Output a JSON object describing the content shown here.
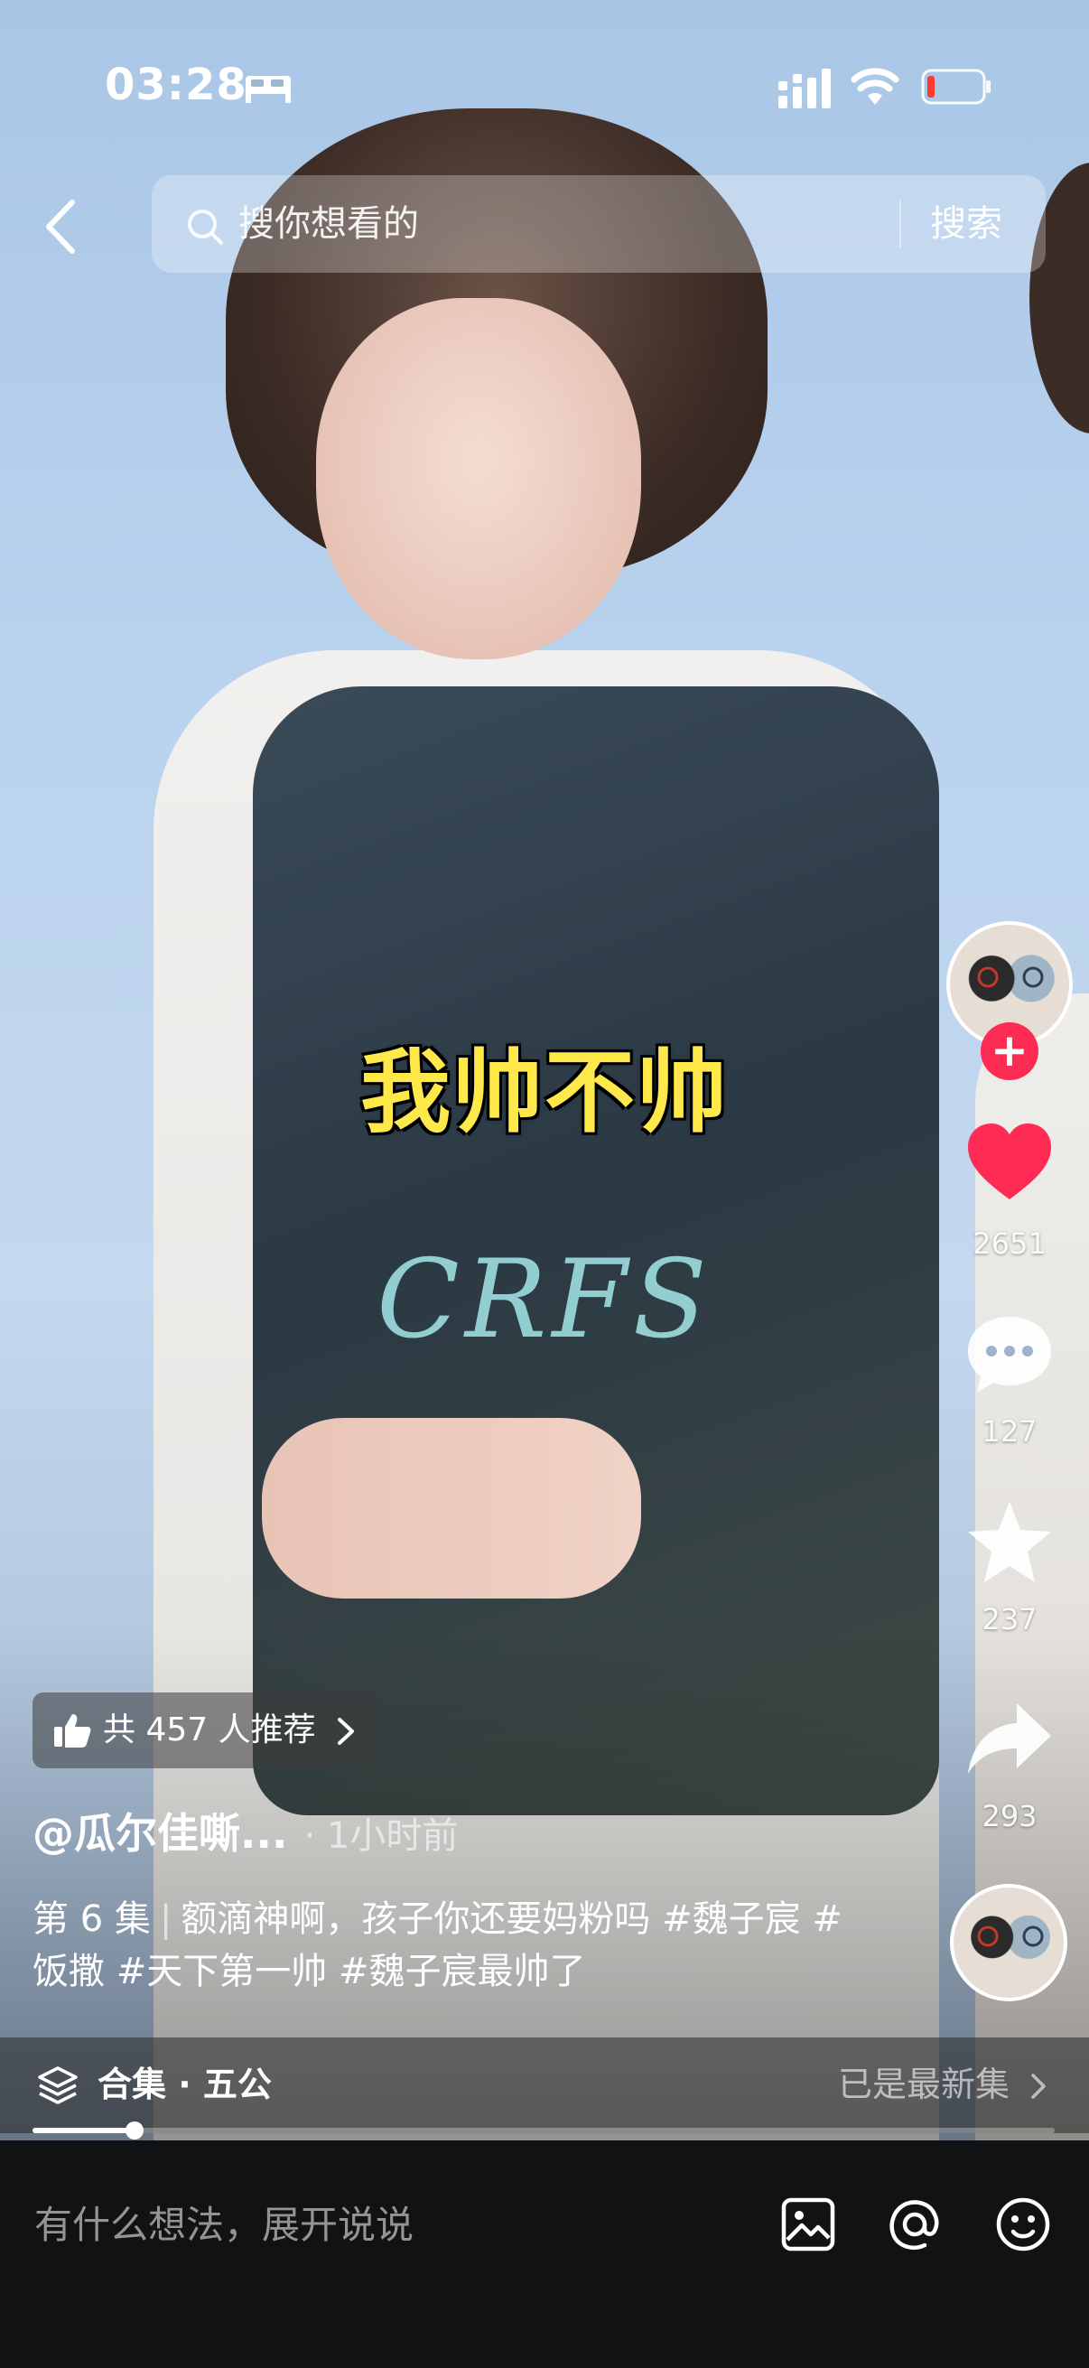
{
  "status_bar": {
    "time": "03:28"
  },
  "search": {
    "placeholder": "搜你想看的",
    "button_label": "搜索"
  },
  "video": {
    "caption_overlay": "我帅不帅",
    "watermark": "CRFS"
  },
  "actions": {
    "like_count": "2651",
    "comment_count": "127",
    "favorite_count": "237",
    "share_count": "293"
  },
  "recommend": {
    "label": "共 457 人推荐"
  },
  "post": {
    "author": "@瓜尔佳嘶...",
    "time_ago": "· 1小时前",
    "episode": "第 6 集",
    "separator": "|",
    "text": "额滴神啊，孩子你还要妈粉吗 #魏子宸 #饭撒 #天下第一帅 #魏子宸最帅了"
  },
  "collection": {
    "label": "合集 · 五公",
    "status": "已是最新集"
  },
  "playback": {
    "progress": 0.1
  },
  "comment_bar": {
    "placeholder": "有什么想法，展开说说"
  },
  "colors": {
    "like": "#fe2c55",
    "caption": "#ffe84a",
    "follow": "#fe2c55"
  },
  "icons": [
    "bed-icon",
    "signal-icon",
    "wifi-icon",
    "battery-icon",
    "back-icon",
    "search-icon",
    "heart-icon",
    "comment-icon",
    "star-icon",
    "share-icon",
    "thumbs-up-icon",
    "layers-icon",
    "image-icon",
    "at-icon",
    "emoji-icon"
  ]
}
